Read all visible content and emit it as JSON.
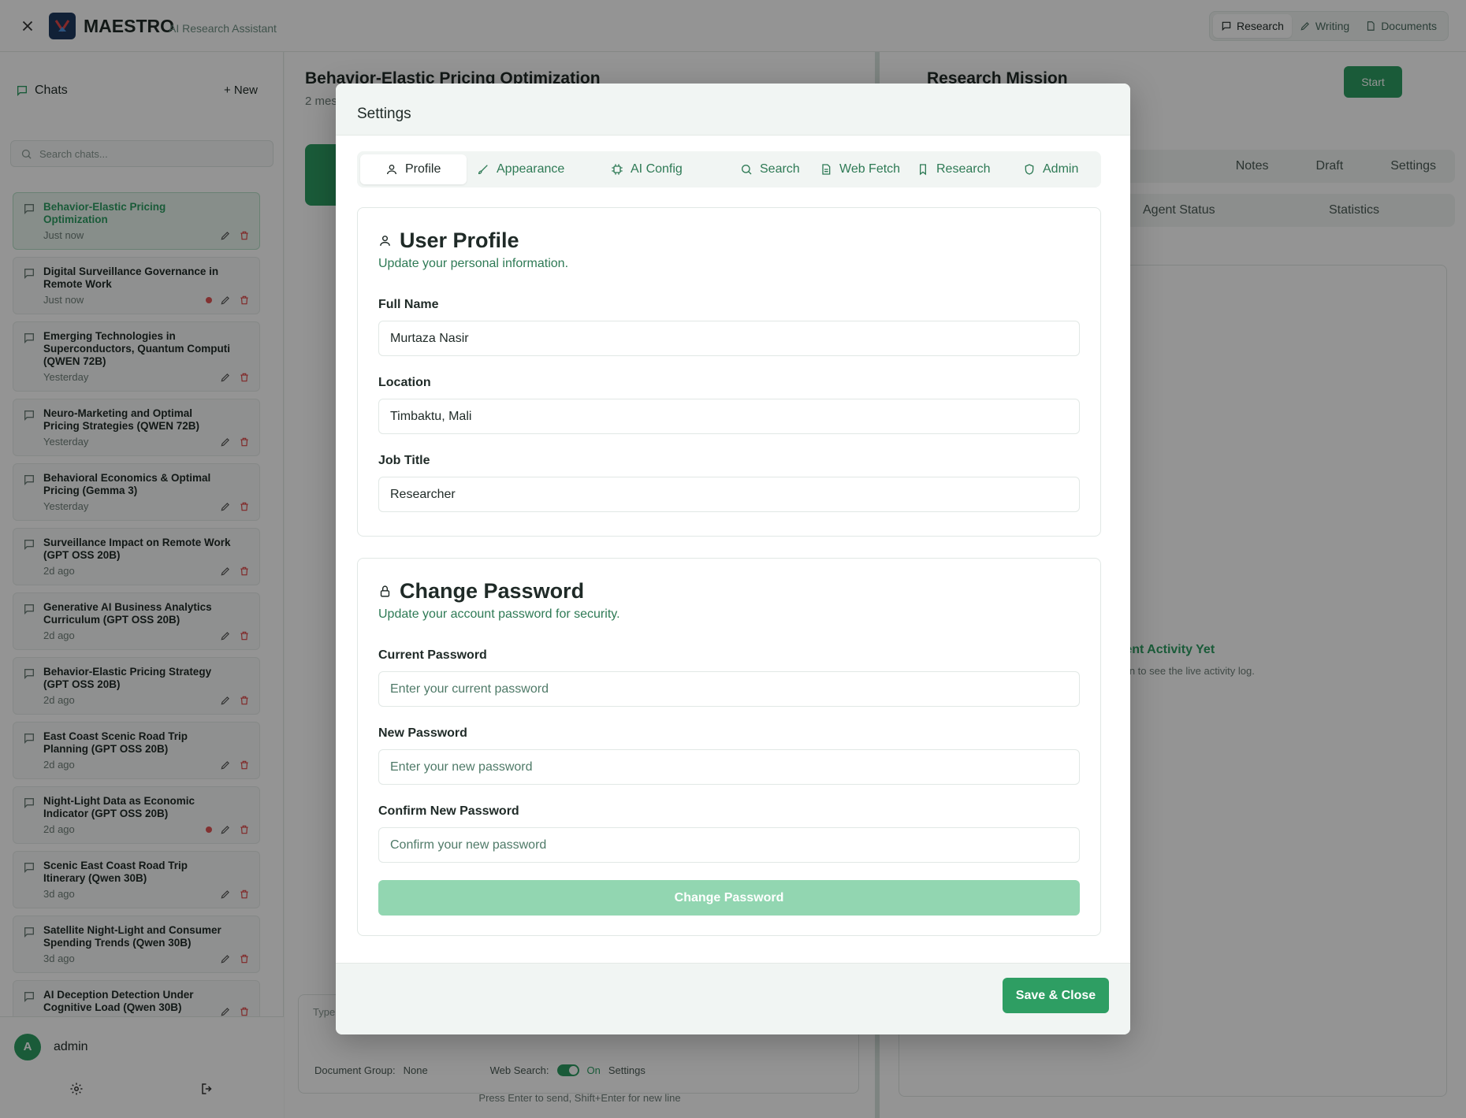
{
  "app": {
    "name": "MAESTRO",
    "subtitle": "AI Research Assistant"
  },
  "modes": [
    {
      "label": "Research",
      "active": true
    },
    {
      "label": "Writing"
    },
    {
      "label": "Documents"
    }
  ],
  "sidebar": {
    "heading": "Chats",
    "new_label": "+ New",
    "search_placeholder": "Search chats...",
    "chats": [
      {
        "title": "Behavior-Elastic Pricing Optimization",
        "time": "Just now",
        "selected": true
      },
      {
        "title": "Digital Surveillance Governance in Remote Work",
        "time": "Just now",
        "dot": true
      },
      {
        "title": "Emerging Technologies in Superconductors, Quantum Computi (QWEN 72B)",
        "time": "Yesterday"
      },
      {
        "title": "Neuro-Marketing and Optimal Pricing Strategies (QWEN 72B)",
        "time": "Yesterday"
      },
      {
        "title": "Behavioral Economics & Optimal Pricing (Gemma 3)",
        "time": "Yesterday"
      },
      {
        "title": "Surveillance Impact on Remote Work (GPT OSS 20B)",
        "time": "2d ago"
      },
      {
        "title": "Generative AI Business Analytics Curriculum (GPT OSS 20B)",
        "time": "2d ago"
      },
      {
        "title": "Behavior-Elastic Pricing Strategy (GPT OSS 20B)",
        "time": "2d ago"
      },
      {
        "title": "East Coast Scenic Road Trip Planning (GPT OSS 20B)",
        "time": "2d ago"
      },
      {
        "title": "Night-Light Data as Economic Indicator (GPT OSS 20B)",
        "time": "2d ago",
        "dot": true
      },
      {
        "title": "Scenic East Coast Road Trip Itinerary (Qwen 30B)",
        "time": "3d ago"
      },
      {
        "title": "Satellite Night-Light and Consumer Spending Trends (Qwen 30B)",
        "time": "3d ago"
      },
      {
        "title": "AI Deception Detection Under Cognitive Load (Qwen 30B)",
        "time": ""
      }
    ],
    "user": {
      "initial": "A",
      "name": "admin"
    }
  },
  "conversation": {
    "title": "Behavior-Elastic Pricing Optimization",
    "subtitle": "2 mes",
    "composer": {
      "placeholder": "Type",
      "doc_group_label": "Document Group:",
      "doc_group_value": "None",
      "web_search_label": "Web Search:",
      "web_search_value": "On",
      "settings_label": "Settings"
    },
    "hint": "Press Enter to send, Shift+Enter for new line"
  },
  "mission": {
    "title": "Research Mission",
    "start_label": "Start",
    "tabs": [
      "Notes",
      "Draft",
      "Settings"
    ],
    "subtabs": [
      "Agent Status",
      "Statistics"
    ],
    "empty_title": "Agent Activity Yet",
    "empty_desc": "mission to see the live activity log."
  },
  "modal": {
    "title": "Settings",
    "tabs": [
      {
        "label": "Profile",
        "icon": "user-icon",
        "active": true
      },
      {
        "label": "Appearance",
        "icon": "brush-icon"
      },
      {
        "label": "AI Config",
        "icon": "chip-icon"
      },
      {
        "label": "Search",
        "icon": "search-icon"
      },
      {
        "label": "Web Fetch",
        "icon": "file-icon"
      },
      {
        "label": "Research",
        "icon": "bookmark-icon"
      },
      {
        "label": "Admin",
        "icon": "shield-icon"
      }
    ],
    "profile": {
      "title": "User Profile",
      "desc": "Update your personal information.",
      "full_name_label": "Full Name",
      "full_name": "Murtaza Nasir",
      "location_label": "Location",
      "location": "Timbaktu, Mali",
      "job_title_label": "Job Title",
      "job_title": "Researcher"
    },
    "password": {
      "title": "Change Password",
      "desc": "Update your account password for security.",
      "current_label": "Current Password",
      "current_placeholder": "Enter your current password",
      "new_label": "New Password",
      "new_placeholder": "Enter your new password",
      "confirm_label": "Confirm New Password",
      "confirm_placeholder": "Confirm your new password",
      "button": "Change Password"
    },
    "save_label": "Save & Close"
  }
}
